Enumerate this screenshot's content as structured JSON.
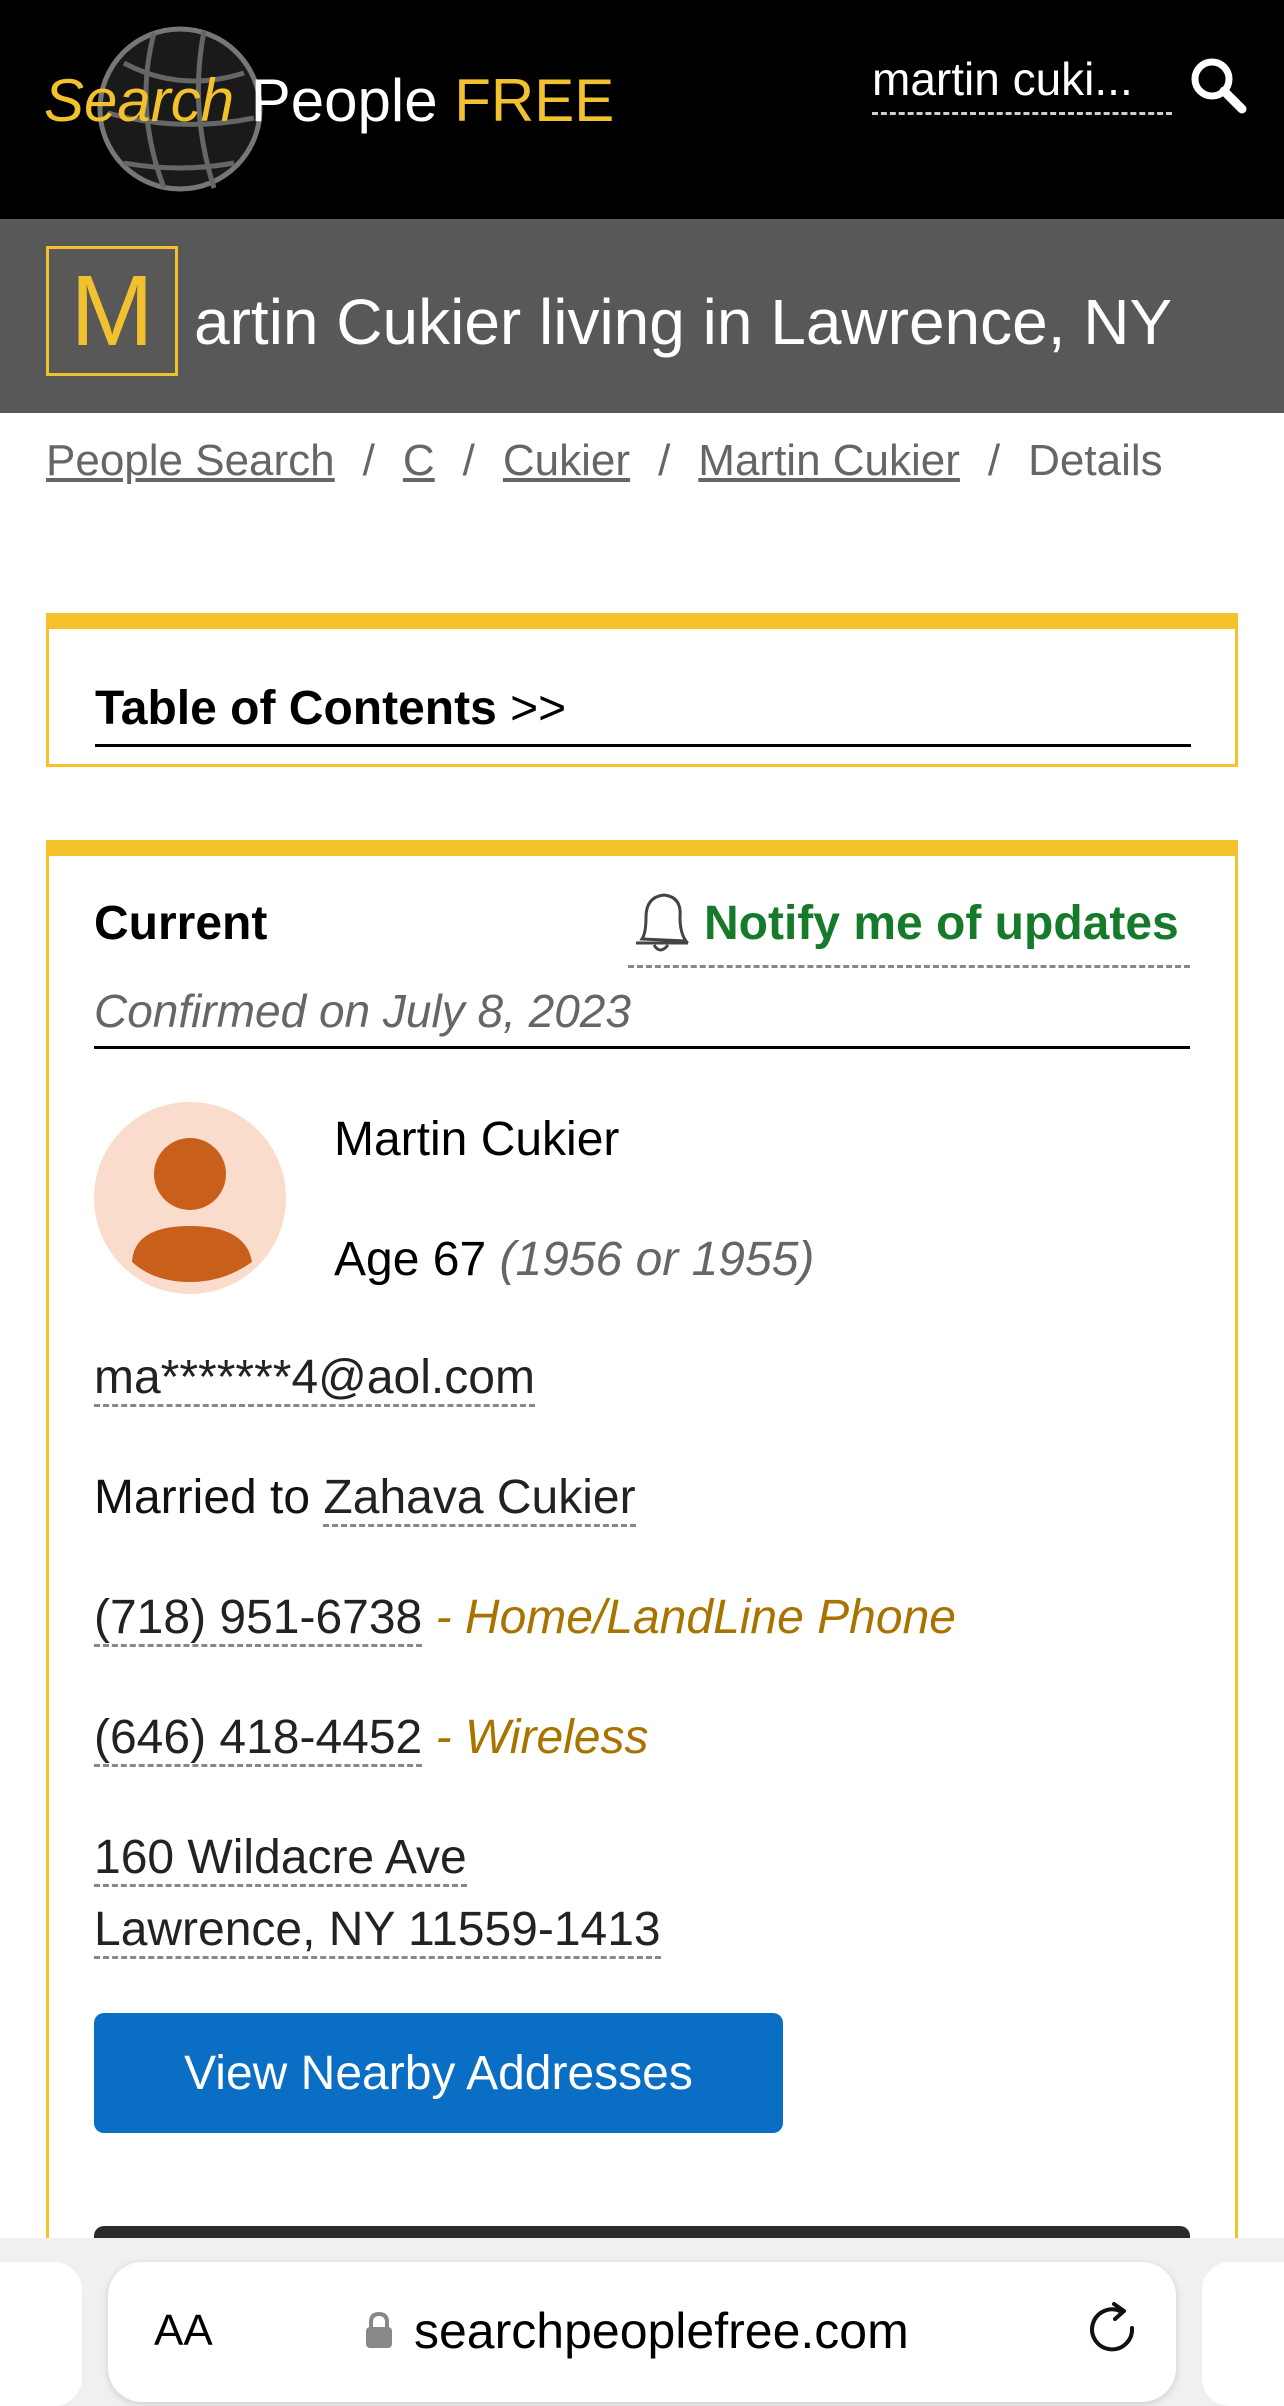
{
  "header": {
    "logo": {
      "part1": "Search",
      "part2": "People",
      "part3": "FREE"
    },
    "search_query": "martin cuki..."
  },
  "title": {
    "initial": "M",
    "rest": "artin Cukier living in Lawrence, NY"
  },
  "breadcrumb": {
    "items": [
      "People Search",
      "C",
      "Cukier",
      "Martin Cukier"
    ],
    "current": "Details",
    "separator": "/"
  },
  "toc": {
    "label_bold": "Table of Contents",
    "label_suffix": ">>"
  },
  "current": {
    "label": "Current",
    "notify": "Notify me of updates",
    "confirmed": "Confirmed on July 8, 2023",
    "name": "Martin Cukier",
    "age": "Age 67",
    "birth_years": "(1956 or 1955)",
    "email": "ma*******4@aol.com",
    "married_prefix": "Married to",
    "spouse": "Zahava Cukier",
    "phones": [
      {
        "number": "(718) 951-6738",
        "type": "- Home/LandLine Phone"
      },
      {
        "number": "(646) 418-4452",
        "type": "- Wireless"
      }
    ],
    "address_line1": "160 Wildacre Ave",
    "address_line2": "Lawrence, NY 11559-1413",
    "nearby_button": "View Nearby Addresses"
  },
  "browser": {
    "aa": "AA",
    "url": "searchpeoplefree.com"
  },
  "colors": {
    "accent_yellow": "#f5c22b",
    "notify_green": "#157a2a",
    "button_blue": "#0b6ec5",
    "phone_type": "#a97300"
  }
}
